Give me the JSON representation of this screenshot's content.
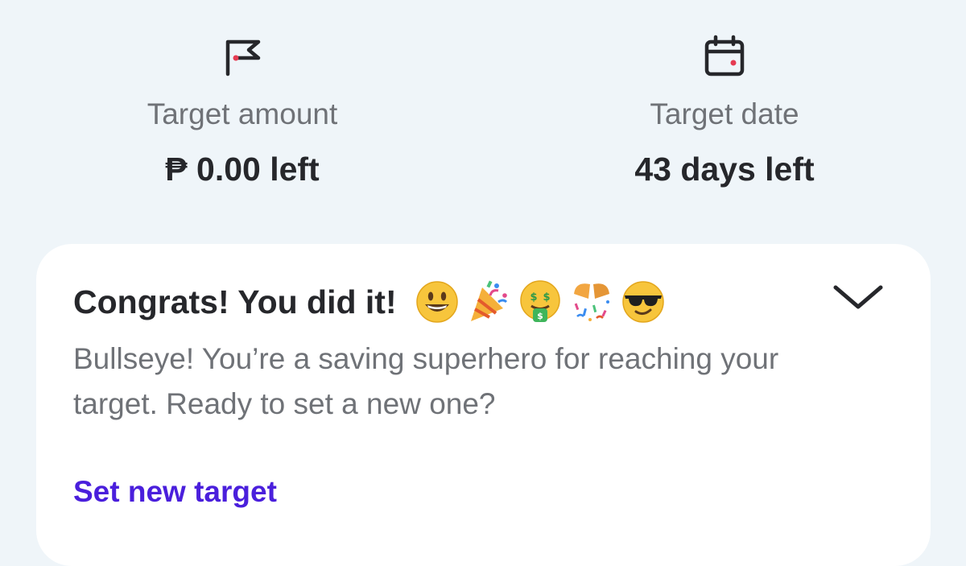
{
  "target_amount": {
    "icon": "flag-icon",
    "label": "Target amount",
    "value": "₱ 0.00 left"
  },
  "target_date": {
    "icon": "calendar-icon",
    "label": "Target date",
    "value": "43 days left"
  },
  "congrats_card": {
    "title": "Congrats! You did it!",
    "emojis": [
      "smiley-emoji",
      "party-popper-emoji",
      "money-mouth-emoji",
      "confetti-ball-emoji",
      "sunglasses-emoji"
    ],
    "message": "Bullseye! You’re a saving superhero for reaching your target. Ready to set a new one?",
    "action_label": "Set new target",
    "collapse_icon": "chevron-down-icon"
  },
  "colors": {
    "background": "#eff5f9",
    "card": "#ffffff",
    "accent": "#4a1fdc",
    "icon_dot": "#e53b52",
    "primary_text": "#26272b",
    "secondary_text": "#6f7277"
  }
}
